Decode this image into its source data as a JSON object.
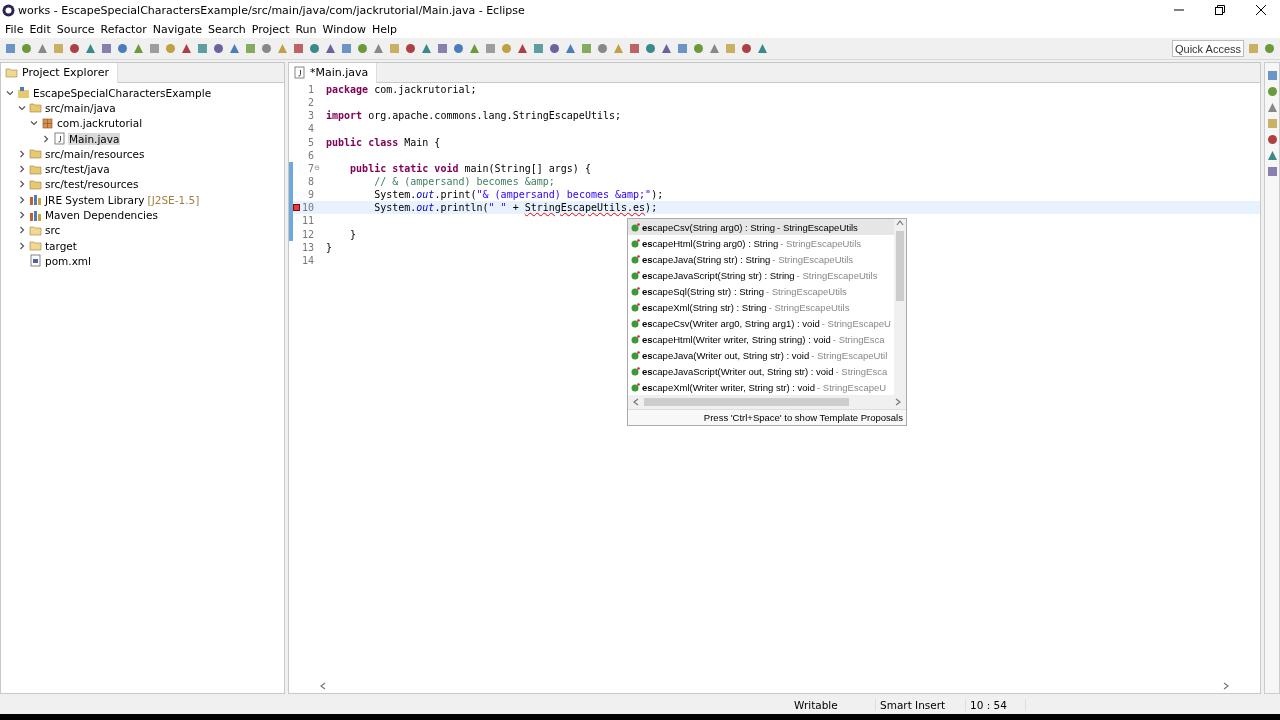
{
  "window": {
    "title": "works - EscapeSpecialCharactersExample/src/main/java/com/jackrutorial/Main.java - Eclipse"
  },
  "menu": [
    "File",
    "Edit",
    "Source",
    "Refactor",
    "Navigate",
    "Search",
    "Project",
    "Run",
    "Window",
    "Help"
  ],
  "quick_access": {
    "placeholder": "Quick Access"
  },
  "project_explorer": {
    "title": "Project Explorer",
    "tree": [
      {
        "label": "EscapeSpecialCharactersExample",
        "kind": "project",
        "expanded": true,
        "selected": false,
        "children": [
          {
            "label": "src/main/java",
            "kind": "source-folder",
            "expanded": true,
            "selected": false,
            "children": [
              {
                "label": "com.jackrutorial",
                "kind": "package",
                "expanded": true,
                "selected": false,
                "children": [
                  {
                    "label": "Main.java",
                    "kind": "java-file",
                    "expanded": false,
                    "selected": true
                  }
                ]
              }
            ]
          },
          {
            "label": "src/main/resources",
            "kind": "source-folder",
            "expanded": false,
            "selected": false
          },
          {
            "label": "src/test/java",
            "kind": "source-folder",
            "expanded": false,
            "selected": false
          },
          {
            "label": "src/test/resources",
            "kind": "source-folder",
            "expanded": false,
            "selected": false
          },
          {
            "label": "JRE System Library",
            "decoration": "[J2SE-1.5]",
            "kind": "library",
            "expanded": false,
            "selected": false
          },
          {
            "label": "Maven Dependencies",
            "kind": "library",
            "expanded": false,
            "selected": false
          },
          {
            "label": "src",
            "kind": "folder",
            "expanded": false,
            "selected": false
          },
          {
            "label": "target",
            "kind": "folder",
            "expanded": false,
            "selected": false
          },
          {
            "label": "pom.xml",
            "kind": "xml-file",
            "selected": false
          }
        ]
      }
    ]
  },
  "editor": {
    "tab": {
      "label": "*Main.java",
      "selected": true
    },
    "lines": [
      {
        "number": "1",
        "changed": false,
        "error": false,
        "current": false,
        "segments": [
          {
            "kind": "keyword",
            "text": "package"
          },
          {
            "kind": "plain",
            "text": " com.jackrutorial;"
          }
        ]
      },
      {
        "number": "2",
        "changed": false,
        "error": false,
        "current": false
      },
      {
        "number": "3",
        "changed": false,
        "error": false,
        "current": false,
        "segments": [
          {
            "kind": "keyword",
            "text": "import"
          },
          {
            "kind": "plain",
            "text": " org.apache.commons.lang.StringEscapeUtils;"
          }
        ]
      },
      {
        "number": "4",
        "changed": false,
        "error": false,
        "current": false
      },
      {
        "number": "5",
        "changed": false,
        "error": false,
        "current": false,
        "segments": [
          {
            "kind": "keyword",
            "text": "public class"
          },
          {
            "kind": "plain",
            "text": " Main {"
          }
        ]
      },
      {
        "number": "6",
        "changed": false,
        "error": false,
        "current": false
      },
      {
        "number": "7",
        "changed": true,
        "error": false,
        "current": false,
        "fold": "⊖",
        "segments": [
          {
            "kind": "keyword",
            "text": "    public static void"
          },
          {
            "kind": "plain",
            "text": " main(String[] args) {"
          }
        ]
      },
      {
        "number": "8",
        "changed": true,
        "error": false,
        "current": false,
        "segments": [
          {
            "kind": "comment",
            "text": "        // & (ampersand) becomes &amp;"
          }
        ]
      },
      {
        "number": "9",
        "changed": true,
        "error": false,
        "current": false,
        "segments": [
          {
            "kind": "plain",
            "text": "        System."
          },
          {
            "kind": "field",
            "text": "out"
          },
          {
            "kind": "plain",
            "text": ".print("
          },
          {
            "kind": "string",
            "text": "\"& (ampersand) becomes &amp;\""
          },
          {
            "kind": "plain",
            "text": ");"
          }
        ]
      },
      {
        "number": "10",
        "changed": true,
        "error": true,
        "current": true,
        "segments": [
          {
            "kind": "plain",
            "text": "        System."
          },
          {
            "kind": "field",
            "text": "out"
          },
          {
            "kind": "plain",
            "text": ".println("
          },
          {
            "kind": "string",
            "text": "\" \""
          },
          {
            "kind": "plain",
            "text": " + "
          },
          {
            "kind": "error",
            "text": "StringEscapeUtils.es"
          },
          {
            "kind": "plain",
            "text": ");"
          }
        ]
      },
      {
        "number": "11",
        "changed": true,
        "error": false,
        "current": false
      },
      {
        "number": "12",
        "changed": true,
        "error": false,
        "current": false,
        "segments": [
          {
            "kind": "plain",
            "text": "    }"
          }
        ]
      },
      {
        "number": "13",
        "changed": false,
        "error": false,
        "current": false,
        "segments": [
          {
            "kind": "plain",
            "text": "}"
          }
        ]
      },
      {
        "number": "14",
        "changed": false,
        "error": false,
        "current": false
      }
    ]
  },
  "content_assist": {
    "proposals": [
      {
        "signature": "**es**capeCsv(String arg0) : String",
        "qualifier": "- StringEscapeUtils",
        "selected": true
      },
      {
        "signature": "**es**capeHtml(String arg0) : String",
        "qualifier": "- StringEscapeUtils",
        "selected": false
      },
      {
        "signature": "**es**capeJava(String str) : String",
        "qualifier": "- StringEscapeUtils",
        "selected": false
      },
      {
        "signature": "**es**capeJavaScript(String str) : String",
        "qualifier": "- StringEscapeUtils",
        "selected": false
      },
      {
        "signature": "**es**capeSql(String str) : String",
        "qualifier": "- StringEscapeUtils",
        "selected": false
      },
      {
        "signature": "**es**capeXml(String str) : String",
        "qualifier": "- StringEscapeUtils",
        "selected": false
      },
      {
        "signature": "**es**capeCsv(Writer arg0, String arg1) : void",
        "qualifier": "- StringEscapeU",
        "selected": false
      },
      {
        "signature": "**es**capeHtml(Writer writer, String string) : void",
        "qualifier": "- StringEsca",
        "selected": false
      },
      {
        "signature": "**es**capeJava(Writer out, String str) : void",
        "qualifier": "- StringEscapeUtil",
        "selected": false
      },
      {
        "signature": "**es**capeJavaScript(Writer out, String str) : void",
        "qualifier": "- StringEsca",
        "selected": false
      },
      {
        "signature": "**es**capeXml(Writer writer, String str) : void",
        "qualifier": "- StringEscapeU",
        "selected": false
      }
    ],
    "hint": "Press 'Ctrl+Space' to show Template Proposals"
  },
  "status_bar": [
    "Writable",
    "Smart Insert",
    "10 : 54"
  ]
}
